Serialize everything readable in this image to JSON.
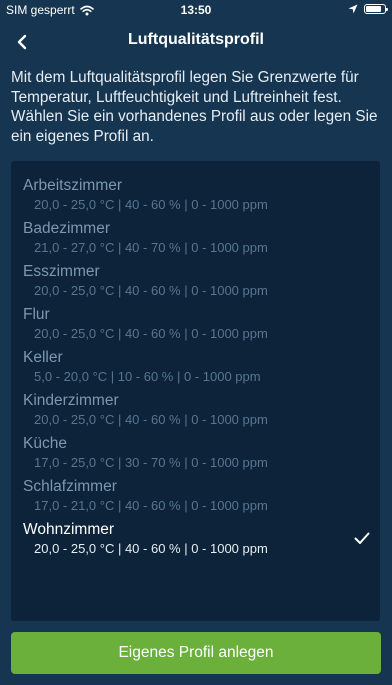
{
  "status_bar": {
    "carrier": "SIM gesperrt",
    "time": "13:50",
    "battery_level": 0.85
  },
  "nav": {
    "title": "Luftqualitätsprofil"
  },
  "intro_text": "Mit dem Luftqualitätsprofil legen Sie Grenzwerte für Temperatur, Luftfeuchtigkeit und Luftreinheit fest. Wählen Sie ein vorhandenes Profil aus oder legen Sie ein eigenes Profil an.",
  "profiles": [
    {
      "name": "Arbeitszimmer",
      "values": "20,0 - 25,0 °C  |  40 - 60 %  |  0 - 1000 ppm"
    },
    {
      "name": "Badezimmer",
      "values": "21,0 - 27,0 °C  |  40 - 70 %  |  0 - 1000 ppm"
    },
    {
      "name": "Esszimmer",
      "values": "20,0 - 25,0 °C  |  40 - 60 %  |  0 - 1000 ppm"
    },
    {
      "name": "Flur",
      "values": "20,0 - 25,0 °C  |  40 - 60 %  |  0 - 1000 ppm"
    },
    {
      "name": "Keller",
      "values": "5,0 - 20,0 °C  |  10 - 60 %  |  0 - 1000 ppm"
    },
    {
      "name": "Kinderzimmer",
      "values": "20,0 - 25,0 °C  |  40 - 60 %  |  0 - 1000 ppm"
    },
    {
      "name": "Küche",
      "values": "17,0 - 25,0 °C  |  30 - 70 %  |  0 - 1000 ppm"
    },
    {
      "name": "Schlafzimmer",
      "values": "17,0 - 21,0 °C  |  40 - 60 %  |  0 - 1000 ppm"
    },
    {
      "name": "Wohnzimmer",
      "values": "20,0 - 25,0 °C  |  40 - 60 %  |  0 - 1000 ppm",
      "selected": true
    }
  ],
  "create_button_label": "Eigenes Profil anlegen",
  "colors": {
    "background": "#163550",
    "panel": "#0c2339",
    "button": "#6bb03a"
  },
  "icons": [
    "wifi-icon",
    "location-arrow-icon",
    "battery-icon",
    "back-chevron-icon",
    "checkmark-icon"
  ]
}
